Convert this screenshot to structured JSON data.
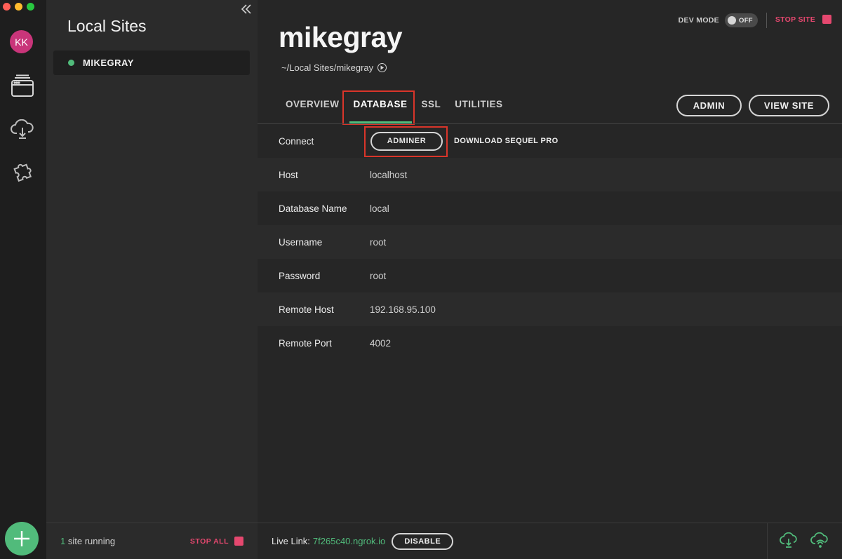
{
  "rail": {
    "avatar_initials": "KK",
    "icons": [
      "sites-icon",
      "cloud-icon",
      "addons-icon"
    ],
    "add_icon": "plus-icon"
  },
  "sidebar": {
    "title": "Local Sites",
    "collapse_icon": "double-chevron-left-icon",
    "sites": [
      {
        "name": "MIKEGRAY",
        "status": "running"
      }
    ],
    "footer": {
      "count": "1",
      "running_text": "site running",
      "stop_all_label": "STOP ALL"
    }
  },
  "header": {
    "dev_mode_label": "DEV MODE",
    "dev_mode_state": "OFF",
    "stop_site_label": "STOP SITE",
    "site_title": "mikegray",
    "site_path": "~/Local Sites/mikegray",
    "admin_button": "ADMIN",
    "view_site_button": "VIEW SITE"
  },
  "tabs": [
    {
      "label": "OVERVIEW",
      "active": false
    },
    {
      "label": "DATABASE",
      "active": true
    },
    {
      "label": "SSL",
      "active": false
    },
    {
      "label": "UTILITIES",
      "active": false
    }
  ],
  "database": {
    "connect_label": "Connect",
    "adminer_button": "ADMINER",
    "sequel_pro_link": "DOWNLOAD SEQUEL PRO",
    "fields": [
      {
        "label": "Host",
        "value": "localhost"
      },
      {
        "label": "Database Name",
        "value": "local"
      },
      {
        "label": "Username",
        "value": "root"
      },
      {
        "label": "Password",
        "value": "root"
      },
      {
        "label": "Remote Host",
        "value": "192.168.95.100"
      },
      {
        "label": "Remote Port",
        "value": "4002"
      }
    ]
  },
  "footer": {
    "live_link_label": "Live Link:",
    "live_link_url": "7f265c40.ngrok.io",
    "disable_button": "DISABLE",
    "icons": [
      "cloud-download-icon",
      "cloud-sync-icon"
    ]
  },
  "colors": {
    "accent_green": "#51bb7b",
    "stop_red": "#e5486f",
    "highlight_red": "#d9352a"
  }
}
